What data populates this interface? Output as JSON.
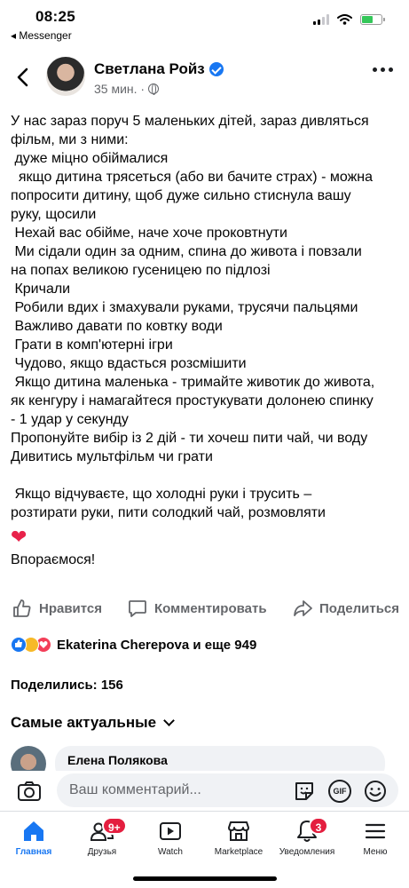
{
  "status": {
    "time": "08:25",
    "back_app": "◂ Messenger"
  },
  "post": {
    "author": "Светлана Ройз",
    "time_ago": "35 мин. ·",
    "lines": [
      "У нас зараз поруч 5 маленьких дітей, зараз дивляться",
      "фільм, ми з ними:",
      " дуже міцно обіймалися",
      "  якщо дитина трясеться (або ви бачите страх) - можна",
      "попросити дитину, щоб дуже сильно стиснула вашу",
      "руку, щосили",
      " Нехай вас обійме, наче хоче проковтнути",
      " Ми сідали один за одним, спина до живота і повзали",
      "на попах великою гусеницею по підлозі",
      " Кричали",
      " Робили вдих і змахували руками, трусячи пальцями",
      " Важливо давати по ковтку води",
      " Грати в комп'ютерні ігри",
      " Чудово, якщо вдасться розсмішити",
      " Якщо дитина маленька - тримайте животик до живота,",
      "як кенгуру і намагайтеся простукувати долонею спинку",
      "- 1 удар у секунду",
      "Пропонуйте вибір із 2 дій - ти хочеш пити чай, чи воду",
      "Дивитись мультфільм чи грати",
      "",
      " Якщо відчуваєте, що холодні руки і трусить –",
      "розтирати руки, пити солодкий чай, розмовляти"
    ],
    "heart": "❤",
    "closing": "Впораємося!"
  },
  "actions": {
    "like": "Нравится",
    "comment": "Комментировать",
    "share": "Поделиться"
  },
  "reactions": {
    "text": "Ekaterina Cherepova и еще 949"
  },
  "shares": "Поделились: 156",
  "sort_label": "Самые актуальные",
  "comment_preview": {
    "author": "Елена Полякова"
  },
  "comment_input": {
    "placeholder": "Ваш комментарий..."
  },
  "tabs": [
    {
      "label": "Главная",
      "active": true
    },
    {
      "label": "Друзья",
      "badge": "9+"
    },
    {
      "label": "Watch"
    },
    {
      "label": "Marketplace"
    },
    {
      "label": "Уведомления",
      "badge": "3"
    },
    {
      "label": "Меню"
    }
  ],
  "colors": {
    "accent": "#1877f2",
    "badge": "#e41e3f",
    "muted": "#65676b",
    "heart": "#e8224a"
  }
}
